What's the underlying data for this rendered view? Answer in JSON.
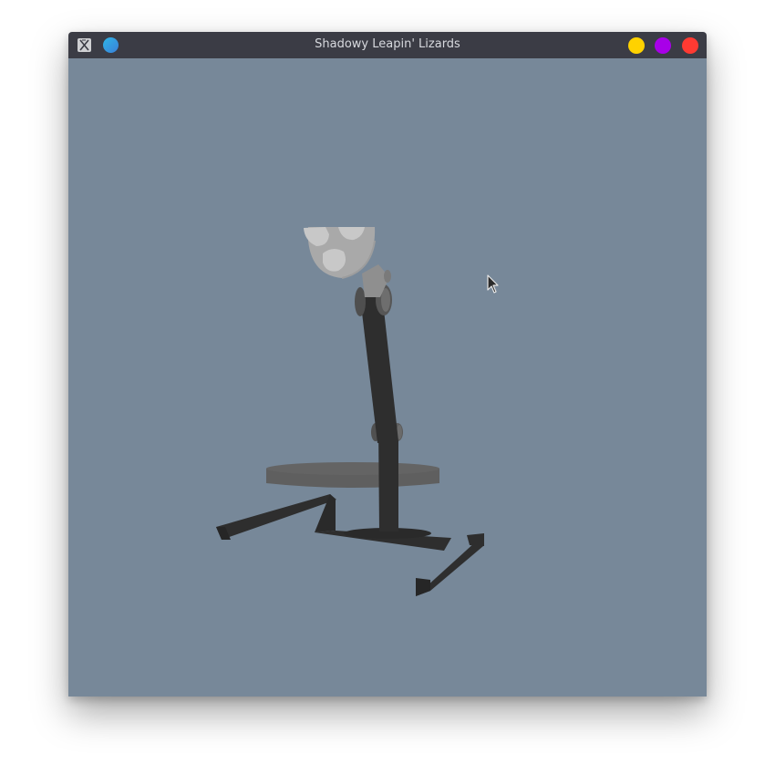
{
  "window": {
    "title": "Shadowy Leapin' Lizards",
    "app_icon": "x-window-icon",
    "sticky_button": "sticky-icon",
    "buttons": [
      {
        "name": "minimize",
        "color": "#ffd200"
      },
      {
        "name": "maximize",
        "color": "#a800e8"
      },
      {
        "name": "close",
        "color": "#ff3a32"
      }
    ]
  },
  "scene": {
    "background_color": "#778899",
    "object": "desk lamp",
    "colors": {
      "frame": "#2e2e2e",
      "table": "#5f5f5f",
      "lamp_head": "#a9a9a9",
      "bulbs": "#c8c8c8",
      "joints": "#5a5a5a"
    }
  },
  "cursor": {
    "icon": "arrow-cursor-icon"
  }
}
